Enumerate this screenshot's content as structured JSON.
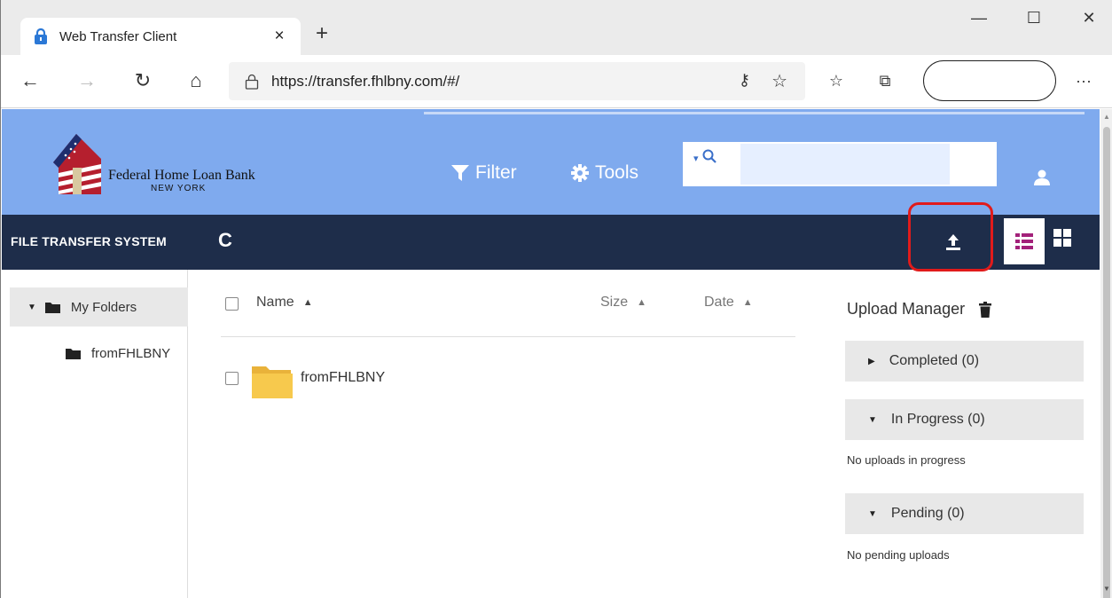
{
  "browser": {
    "tab_title": "Web Transfer Client",
    "tab_close": "×",
    "new_tab": "+",
    "url": "https://transfer.fhlbny.com/#/",
    "controls": {
      "minimize": "—",
      "maximize": "☐",
      "close": "✕"
    },
    "nav": {
      "back": "←",
      "forward": "→",
      "refresh": "↻",
      "home": "⌂"
    },
    "toolbar_icons": [
      "key-icon",
      "favorite-star-icon",
      "favorites-list-icon",
      "collections-icon",
      "more-icon"
    ],
    "more_label": "···"
  },
  "header": {
    "logo_line1": "Federal Home Loan Bank",
    "logo_line2": "NEW YORK",
    "filter_label": "Filter",
    "tools_label": "Tools",
    "search_value": "",
    "search_caret": "▾",
    "colors": {
      "header_bg": "#7faaee",
      "toolbar_bg": "#1e2d4a",
      "highlight": "#e11b1b"
    }
  },
  "toolbar": {
    "app_name": "FILE TRANSFER SYSTEM",
    "refresh_icon": "C"
  },
  "sidebar": {
    "root_label": "My Folders",
    "children": [
      "fromFHLBNY"
    ]
  },
  "file_list": {
    "columns": {
      "name": "Name",
      "size": "Size",
      "date": "Date"
    },
    "sort_glyph": "▲",
    "rows": [
      {
        "name": "fromFHLBNY",
        "type": "folder"
      }
    ]
  },
  "upload_manager": {
    "title": "Upload Manager",
    "completed": "Completed (0)",
    "in_progress": "In Progress (0)",
    "in_progress_note": "No uploads in progress",
    "pending": "Pending (0)",
    "pending_note": "No pending uploads"
  }
}
